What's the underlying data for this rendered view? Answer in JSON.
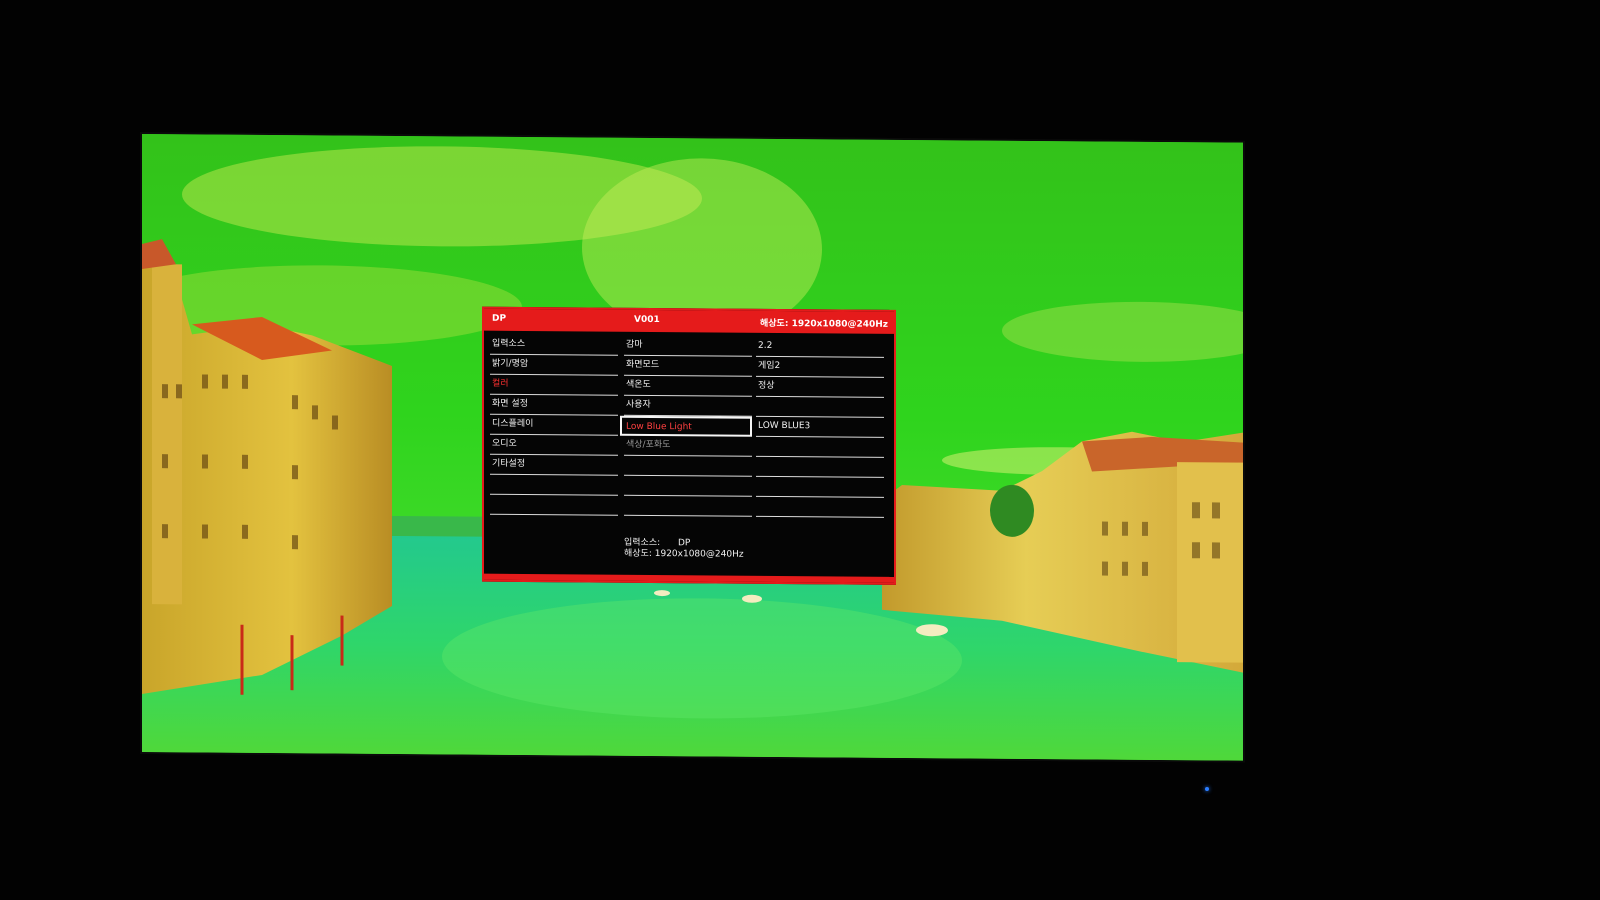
{
  "colors": {
    "osd_accent": "#e51b1b",
    "osd_background": "#050505",
    "active_text": "#ff3030",
    "power_led": "#2b7dff"
  },
  "osd": {
    "header": {
      "source": "DP",
      "model": "V001",
      "resolution": "해상도:  1920x1080@240Hz"
    },
    "menu": [
      {
        "label": "입력소스"
      },
      {
        "label": "밝기/명암"
      },
      {
        "label": "컬러"
      },
      {
        "label": "화면 설정"
      },
      {
        "label": "디스플레이"
      },
      {
        "label": "오디오"
      },
      {
        "label": "기타설정"
      }
    ],
    "submenu": [
      {
        "label": "감마"
      },
      {
        "label": "화면모드"
      },
      {
        "label": "색온도"
      },
      {
        "label": "사용자"
      },
      {
        "label": "Low Blue Light"
      },
      {
        "label": "색상/포화도"
      }
    ],
    "values": [
      {
        "label": "2.2"
      },
      {
        "label": "게임2"
      },
      {
        "label": "정상"
      },
      {
        "label": ""
      },
      {
        "label": "LOW BLUE3"
      }
    ],
    "info": {
      "source_label": "입력소스:",
      "source_value": "DP",
      "resolution_label": "해상도:",
      "resolution_value": "1920x1080@240Hz"
    }
  }
}
